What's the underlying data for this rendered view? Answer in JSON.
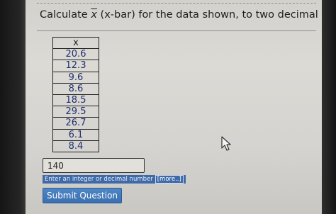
{
  "question": {
    "prefix": "Calculate ",
    "xbar_symbol": "x",
    "suffix": " (x-bar) for the data shown, to two decimal places"
  },
  "table": {
    "header": "x",
    "values": [
      "20.6",
      "12.3",
      "9.6",
      "8.6",
      "18.5",
      "29.5",
      "26.7",
      "6.1",
      "8.4"
    ]
  },
  "answer": {
    "value": "140"
  },
  "hint": {
    "text": "Enter an integer or decimal number",
    "more_label": "[more..]"
  },
  "submit": {
    "label": "Submit Question"
  },
  "colors": {
    "button": "#3a6fb0",
    "hint_bar": "#3e6aa8",
    "table_text": "#1f2f6f"
  }
}
